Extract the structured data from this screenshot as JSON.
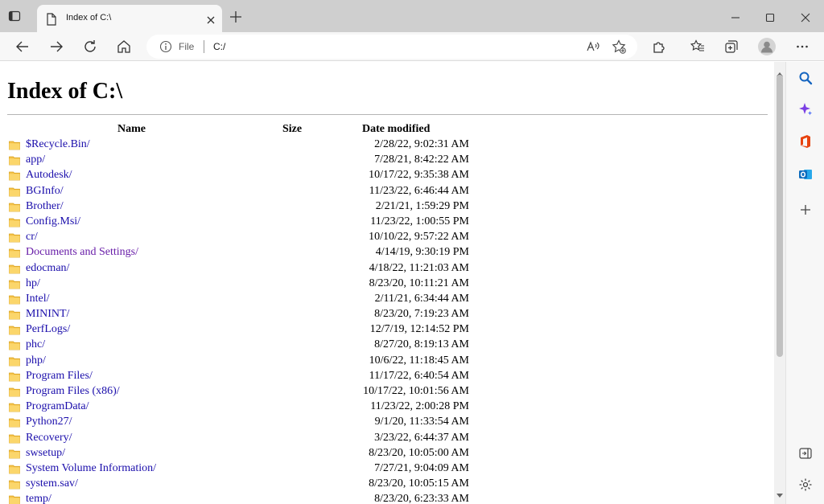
{
  "browser": {
    "tab": {
      "title": "Index of C:\\"
    },
    "address": {
      "scheme_label": "File",
      "url": "C:/"
    }
  },
  "page": {
    "title": "Index of C:\\",
    "columns": {
      "name": "Name",
      "size": "Size",
      "date": "Date modified"
    },
    "entries": [
      {
        "name": "$Recycle.Bin/",
        "date": "2/28/22, 9:02:31 AM"
      },
      {
        "name": "app/",
        "date": "7/28/21, 8:42:22 AM"
      },
      {
        "name": "Autodesk/",
        "date": "10/17/22, 9:35:38 AM"
      },
      {
        "name": "BGInfo/",
        "date": "11/23/22, 6:46:44 AM"
      },
      {
        "name": "Brother/",
        "date": "2/21/21, 1:59:29 PM"
      },
      {
        "name": "Config.Msi/",
        "date": "11/23/22, 1:00:55 PM"
      },
      {
        "name": "cr/",
        "date": "10/10/22, 9:57:22 AM"
      },
      {
        "name": "Documents and Settings/",
        "date": "4/14/19, 9:30:19 PM",
        "visited": true
      },
      {
        "name": "edocman/",
        "date": "4/18/22, 11:21:03 AM"
      },
      {
        "name": "hp/",
        "date": "8/23/20, 10:11:21 AM"
      },
      {
        "name": "Intel/",
        "date": "2/11/21, 6:34:44 AM"
      },
      {
        "name": "MININT/",
        "date": "8/23/20, 7:19:23 AM"
      },
      {
        "name": "PerfLogs/",
        "date": "12/7/19, 12:14:52 PM"
      },
      {
        "name": "phc/",
        "date": "8/27/20, 8:19:13 AM"
      },
      {
        "name": "php/",
        "date": "10/6/22, 11:18:45 AM"
      },
      {
        "name": "Program Files/",
        "date": "11/17/22, 6:40:54 AM"
      },
      {
        "name": "Program Files (x86)/",
        "date": "10/17/22, 10:01:56 AM"
      },
      {
        "name": "ProgramData/",
        "date": "11/23/22, 2:00:28 PM"
      },
      {
        "name": "Python27/",
        "date": "9/1/20, 11:33:54 AM"
      },
      {
        "name": "Recovery/",
        "date": "3/23/22, 6:44:37 AM"
      },
      {
        "name": "swsetup/",
        "date": "8/23/20, 10:05:00 AM"
      },
      {
        "name": "System Volume Information/",
        "date": "7/27/21, 9:04:09 AM"
      },
      {
        "name": "system.sav/",
        "date": "8/23/20, 10:05:15 AM"
      },
      {
        "name": "temp/",
        "date": "8/23/20, 6:23:33 AM"
      }
    ]
  },
  "icons": {
    "tab_actions": "tab-actions-icon",
    "favicon": "page-icon",
    "folder": "folder-icon",
    "sidebar": [
      "search-icon",
      "copilot-icon",
      "office-icon",
      "outlook-icon",
      "add-icon",
      "sidebar-toggle-icon",
      "settings-icon"
    ]
  },
  "colors": {
    "link": "#1a0dab",
    "visited": "#681da8",
    "folder": "#f6c34a",
    "copilot": "#7b3fe4",
    "office": "#e8430f",
    "outlook": "#0f6cbd"
  }
}
